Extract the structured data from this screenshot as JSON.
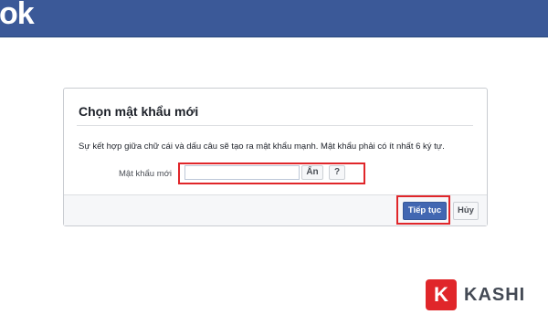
{
  "header": {
    "brand_partial": "ok",
    "brand_color": "#3b5998"
  },
  "dialog": {
    "title": "Chọn mật khẩu mới",
    "hint": "Sự kết hợp giữa chữ cái và dấu câu sẽ tạo ra mật khẩu mạnh. Mật khẩu phải có ít nhất 6 ký tự.",
    "password_label": "Mật khẩu mới",
    "password_value": "",
    "show_label": "Ẩn",
    "help_label": "?",
    "continue_label": "Tiếp tục",
    "cancel_label": "Hủy"
  },
  "watermark": {
    "badge": "K",
    "text": "KASHI"
  },
  "colors": {
    "accent": "#4267b2",
    "highlight": "#e0262a"
  }
}
